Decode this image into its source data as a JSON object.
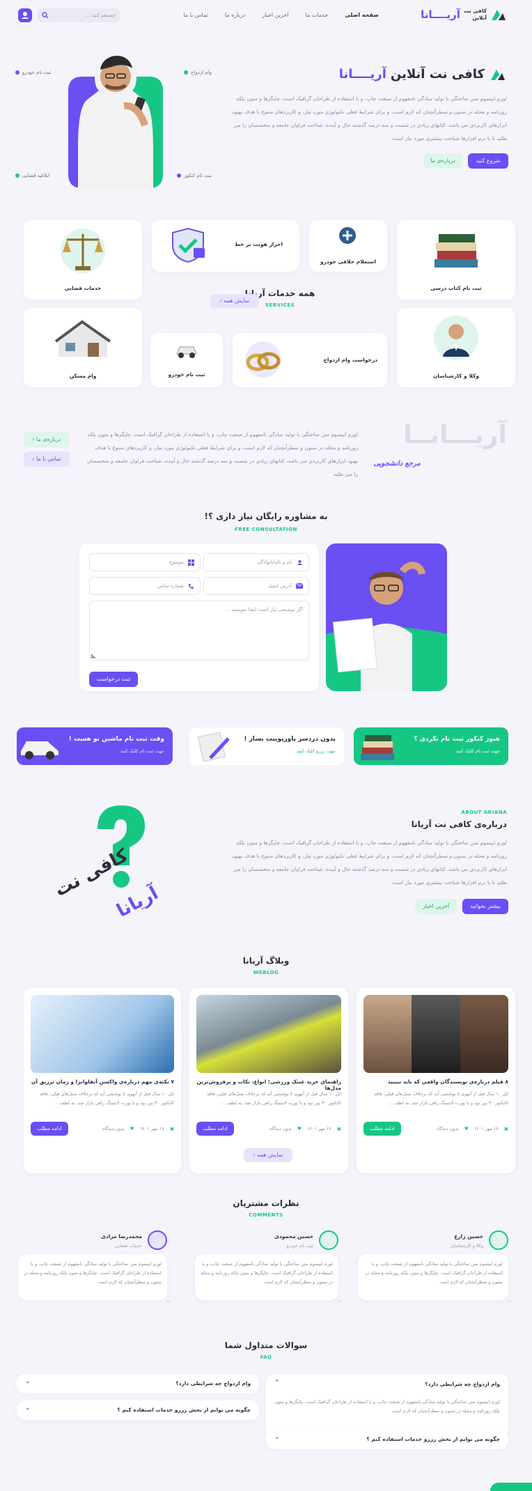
{
  "header": {
    "logo_text": "آریــــانا",
    "logo_sub_1": "کافی نت",
    "logo_sub_2": "آنلاین",
    "nav": [
      "صفحه اصلی",
      "خدمات ما",
      "آخرین اخبار",
      "درباره ما",
      "تماس با ما"
    ],
    "search_placeholder": "جستجو کنید ..."
  },
  "hero": {
    "title_1": "کافی نت آنلاین",
    "title_2": "آریــــانا",
    "text": "لورم ایپسوم متن ساختگی با تولید سادگی نامفهوم از صنعت چاپ، و با استفاده از طراحان گرافیک است، چاپگرها و متون بلکه روزنامه و مجله در ستون و سطرآنچنان که لازم است، و برای شرایط فعلی تکنولوژی مورد نیاز، و کاربردهای متنوع با هدف بهبود ابزارهای کاربردی می باشد، کتابهای زیادی در شصت و سه درصد گذشته حال و آینده، شناخت فراوان جامعه و متخصصان را می طلبد تا با نرم افزارها شناخت بیشتری مورد نیاز است.",
    "start_btn": "شروع کنید",
    "about_btn": "درباره‌ی ما",
    "tags": [
      "وام ازدواج",
      "ثبت نام خودرو",
      "ثبت نام کنکور",
      "ابلاغیه قضایی"
    ]
  },
  "services": {
    "title": "همه خدمات آریانا",
    "eyebrow": "SERVICES",
    "show_all": "نمایش همه",
    "items": [
      "ثبت نام کتاب درسی",
      "استعلام خلافی خودرو",
      "احراز هویت بر خط",
      "خدمات قضایی",
      "وکلا و کارشناسان",
      "درخواست وام ازدواج",
      "ثبت نام خودرو",
      "وام مسکن"
    ]
  },
  "brand": {
    "big": "آریـــانــا",
    "sub": "مرجع  دانشجویی",
    "text": "لورم ایپسوم متن ساختگی با تولید سادگی نامفهوم از صنعت چاپ، و با استفاده از طراحان گرافیک است، چاپگرها و متون بلکه روزنامه و مجله در ستون و سطرآنچنان که لازم است، و برای شرایط فعلی تکنولوژی مورد نیاز، و کاربردهای متنوع با هدف بهبود ابزارهای کاربردی می باشد، کتابهای زیادی در شصت و سه درصد گذشته حال و آینده، شناخت فراوان جامعه و متخصصان را می طلبد",
    "about_btn": "درباره‌ی ما",
    "contact_btn": "تماس با ما"
  },
  "consult": {
    "title": "به مشاوره رایگان نیاز داری ؟!",
    "eyebrow": "FREE CONSULTATION",
    "name_ph": "نام و نام‌خانوادگی",
    "subject_ph": "موضوع",
    "email_ph": "آدرس ایمیل",
    "phone_ph": "شماره تماس",
    "message_ph": "اگر توضیحی نیاز است اینجا بنویسید ...",
    "submit": "ثبت درخواست"
  },
  "promos": [
    {
      "title": "هنوز کنکور ثبت نام نکردی ؟",
      "sub": "جهت ثبت نام کلیک کنید"
    },
    {
      "title": "بدون دردسر پاورپوینت بساز !",
      "sub": "جهت رزرو کلیک کنید"
    },
    {
      "title": "وقت ثبت نام ماشین نو هست !",
      "sub": "جهت ثبت نام کلیک کنید"
    }
  ],
  "about": {
    "eyebrow": "ABOUT ARIANA",
    "title": "درباره‌ی کافی نت آریانا",
    "text": "لورم ایپسوم متن ساختگی با تولید سادگی نامفهوم از صنعت چاپ، و با استفاده از طراحان گرافیک است، چاپگرها و متون بلکه روزنامه و مجله در ستون و سطرآنچنان که لازم است، و برای شرایط فعلی تکنولوژی مورد نیاز، و کاربردهای متنوع با هدف بهبود ابزارهای کاربردی می باشد، کتابهای زیادی در شصت و سه درصد گذشته حال و آینده، شناخت فراوان جامعه و متخصصان را می طلبد تا با نرم افزارها شناخت بیشتری مورد نیاز است.",
    "more_btn": "بیشتر بخوانید",
    "news_btn": "آخرین اخبار",
    "art_1": "کافی نت",
    "art_2": "آریانا"
  },
  "blog": {
    "title": "وبلاگ آریانا",
    "eyebrow": "WEBLOG",
    "show_all": "نمایش همه",
    "posts": [
      {
        "title": "۸ فیلم درباره‌ی نویسندگان واقعی که باید ببینید",
        "excerpt": "ایل ۱۰ سال قبل از آنهوی ۵ پوششی آید که برخلاف نسل‌های قبلی، فاقد کانکتور ۳۰ پین بود و با پورت لایتنینگ راهی بازار شد. به لطف ...",
        "date": "۱۷ مهر ۱۴۰۱",
        "comments": "بدون دیدگاه",
        "btn": "ادامه مطلب"
      },
      {
        "title": "راهنمای خرید عینک ورزشی؛ انواع، نکات و پرفروش‌ترین مدل‌ها",
        "excerpt": "ایل ۱۰ سال قبل از آنهوی ۵ پوششی آید که برخلاف نسل‌های قبلی، فاقد کانکتور ۳۰ پین بود و با پورت لایتنینگ راهی بازار شد. به لطف ...",
        "date": "۱۷ مهر ۱۴۰۱",
        "comments": "بدون دیدگاه",
        "btn": "ادامه مطلب"
      },
      {
        "title": "۷ نکته‌ی مهم درباره‌ی واکسن آنفلوانزا و زمان تزریق آن",
        "excerpt": "ایل ۱۰ سال قبل از آنهوی ۵ پوششی آید که برخلاف نسل‌های قبلی، فاقد کانکتور ۳۰ پین بود و با پورت لایتنینگ راهی بازار شد. به لطف ...",
        "date": "۱۷ مهر ۱۴۰۱",
        "comments": "بدون دیدگاه",
        "btn": "ادامه مطلب"
      }
    ]
  },
  "comments": {
    "title": "نظرات مشتریان",
    "eyebrow": "COMMENTS",
    "items": [
      {
        "name": "حسین زارع",
        "role": "وکلا و کارشناسان",
        "text": "لورم ایپسوم متن ساختگی با تولید سادگی نامفهوم از صنعت چاپ، و با استفاده از طراحان گرافیک است. چاپگرها و متون بلکه روزنامه و مجله در ستون و سطرآنچنان که لازم است"
      },
      {
        "name": "حسین محمودی",
        "role": "ثبت نام خودرو",
        "text": "لورم ایپسوم متن ساختگی با تولید سادگی نامفهوم از صنعت چاپ، و با استفاده از طراحان گرافیک است. چاپگرها و متون بلکه روزنامه و مجله در ستون و سطرآنچنان که لازم است"
      },
      {
        "name": "محمدرضا مرادی",
        "role": "خدمات قضایی",
        "text": "لورم ایپسوم متن ساختگی با تولید سادگی نامفهوم از صنعت چاپ، و با استفاده از طراحان گرافیک است. چاپگرها و متون بلکه روزنامه و مجله در ستون و سطرآنچنان که لازم است"
      }
    ]
  },
  "faq": {
    "title": "سوالات متداول شما",
    "eyebrow": "FAQ",
    "q1": "وام ازدواج چه شرایطی دارد؟",
    "a1": "لورم ایپسوم متن ساختگی با تولید سادگی نامفهوم از صنعت چاپ، و با استفاده از طراحان گرافیک است، چاپگرها و متون بلکه روزنامه و مجله در ستون و سطرآنچنان که لازم است",
    "q2": "چگونه می توانم از بخش رزرو خدمات استفاده کنم ؟",
    "q3": "وام ازدواج چه شرایطی دارد؟",
    "q4": "چگونه می توانم از بخش رزرو خدمات استفاده کنم ؟"
  },
  "colors": {
    "primary": "#6a4ff3",
    "accent": "#16c784",
    "bg": "#f5f4fb"
  }
}
